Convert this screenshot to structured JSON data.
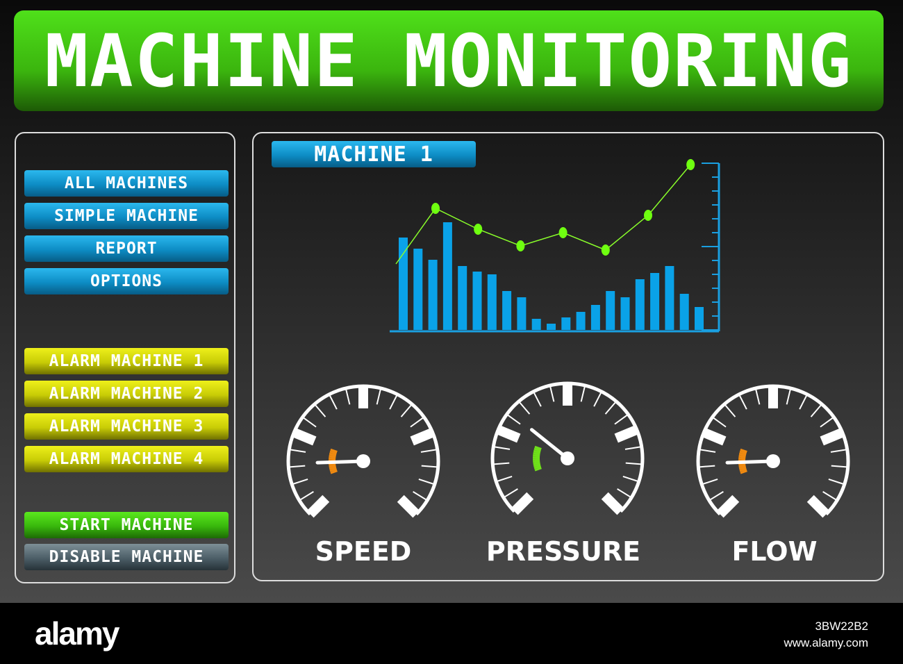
{
  "title": "MACHINE MONITORING",
  "sidebar": {
    "nav": [
      "ALL MACHINES",
      "SIMPLE MACHINE",
      "REPORT",
      "OPTIONS"
    ],
    "alarms": [
      "ALARM MACHINE 1",
      "ALARM MACHINE 2",
      "ALARM MACHINE 3",
      "ALARM MACHINE 4"
    ],
    "start": "START MACHINE",
    "disable": "DISABLE MACHINE"
  },
  "main": {
    "machine_label": "MACHINE 1"
  },
  "chart_data": {
    "type": "bar",
    "bars": [
      133,
      117,
      101,
      155,
      92,
      84,
      80,
      56,
      47,
      16,
      9,
      18,
      26,
      36,
      56,
      47,
      73,
      82,
      92,
      52,
      33
    ],
    "line": [
      95,
      175,
      145,
      121,
      140,
      115,
      165,
      238
    ],
    "ylim": [
      0,
      240
    ],
    "colors": {
      "bar": "#0aa2e8",
      "line": "#8aff2a",
      "axis": "#1a9fe0"
    }
  },
  "gauges": [
    {
      "label": "SPEED",
      "value": 0.16,
      "arc_color": "#f08a10"
    },
    {
      "label": "PRESSURE",
      "value": 0.31,
      "arc_color": "#6fe01a"
    },
    {
      "label": "FLOW",
      "value": 0.16,
      "arc_color": "#f08a10"
    }
  ],
  "footer": {
    "logo": "alamy",
    "image_id": "3BW22B2",
    "site": "www.alamy.com"
  }
}
